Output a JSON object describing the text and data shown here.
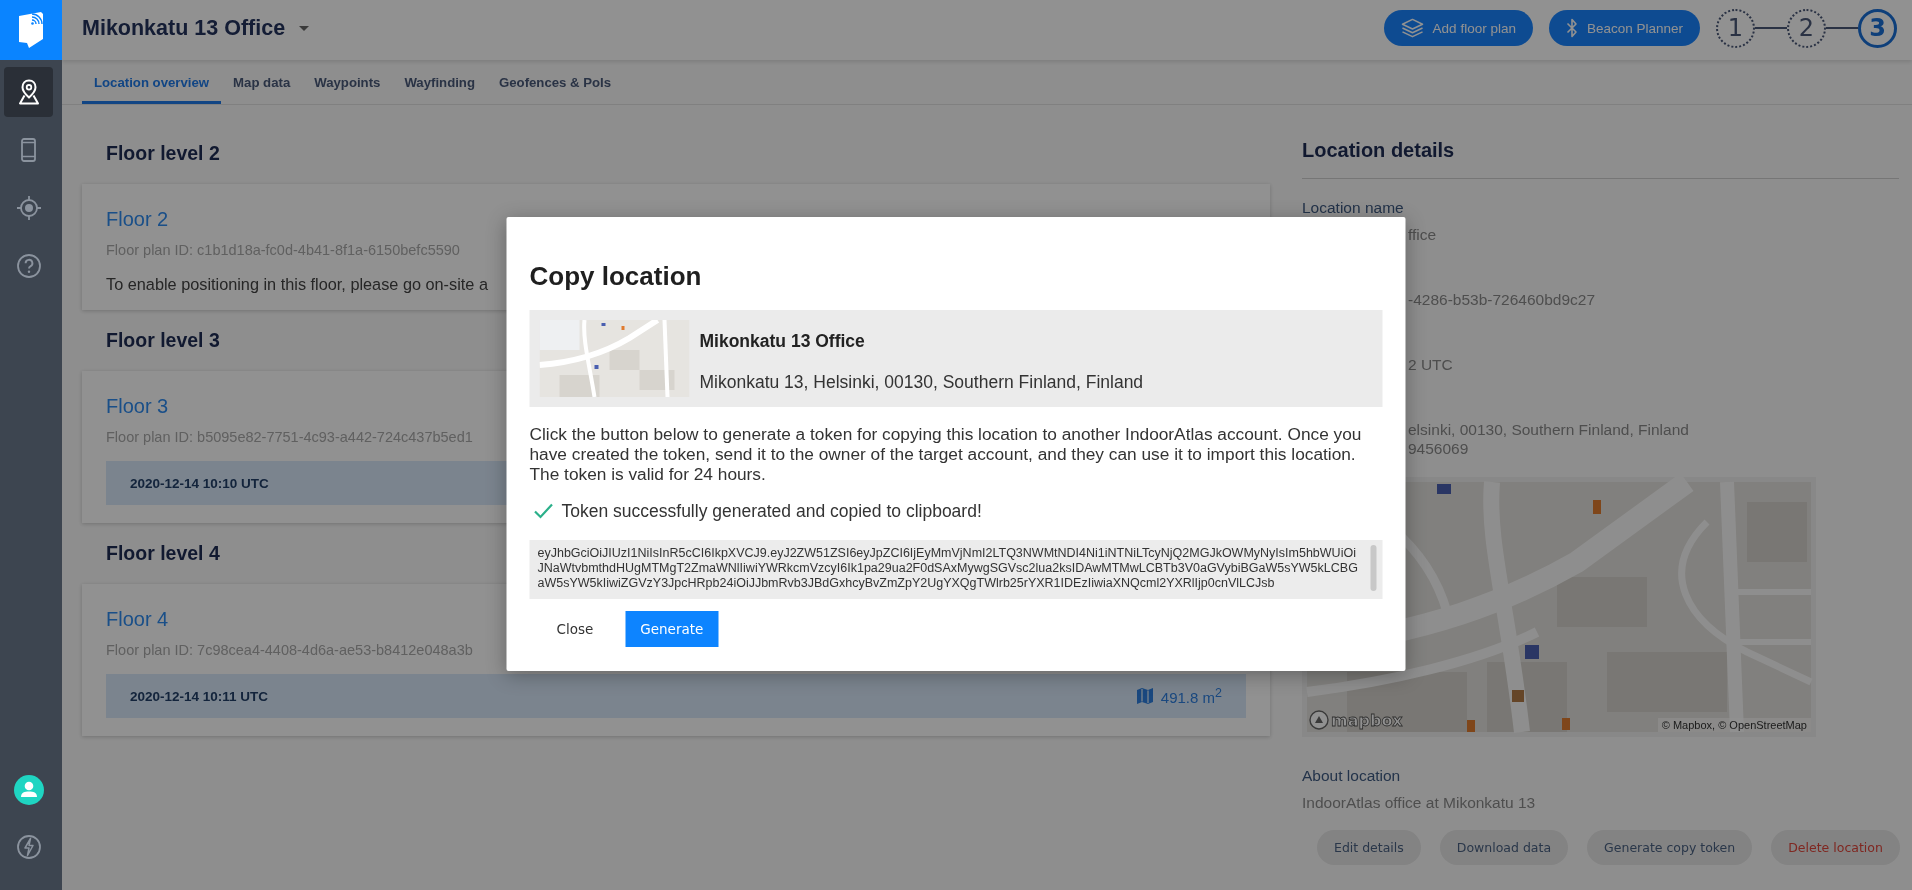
{
  "sidebar": {
    "items": [
      {
        "selected": true
      },
      {
        "selected": false
      },
      {
        "selected": false
      },
      {
        "selected": false
      }
    ]
  },
  "header": {
    "title": "Mikonkatu 13 Office",
    "buttons": [
      {
        "label": "Add floor plan"
      },
      {
        "label": "Beacon Planner"
      }
    ],
    "steps": [
      {
        "label": "1",
        "selected": false
      },
      {
        "label": "2",
        "selected": false
      },
      {
        "label": "3",
        "selected": true
      }
    ]
  },
  "tabs": [
    {
      "label": "Location overview",
      "selected": true
    },
    {
      "label": "Map data",
      "selected": false
    },
    {
      "label": "Waypoints",
      "selected": false
    },
    {
      "label": "Wayfinding",
      "selected": false
    },
    {
      "label": "Geofences & PoIs",
      "selected": false
    }
  ],
  "floors": [
    {
      "heading": "Floor level 2",
      "name": "Floor 2",
      "plan_id": "Floor plan ID: c1b1d18a-fc0d-4b41-8f1a-6150befc5590",
      "kind": "pending",
      "note": "To enable positioning in this floor, please go on-site a"
    },
    {
      "heading": "Floor level 3",
      "name": "Floor 3",
      "plan_id": "Floor plan ID: b5095e82-7751-4c93-a442-724c437b5ed1",
      "kind": "mapped",
      "date": "2020-12-14 10:10 UTC"
    },
    {
      "heading": "Floor level 4",
      "name": "Floor 4",
      "plan_id": "Floor plan ID: 7c98cea4-4408-4d6a-ae53-b8412e048a3b",
      "kind": "mapped",
      "date": "2020-12-14 10:11 UTC",
      "area": "491.8 m$^{2}$"
    }
  ],
  "details": {
    "title": "Location details",
    "fields": [
      {
        "label": "Location name",
        "lines": [
          "ffice"
        ]
      },
      {
        "lines": [
          "-4286-b53b-726460bd9c27"
        ]
      },
      {
        "lines": [
          "2 UTC"
        ]
      },
      {
        "lines": [
          "elsinki, 00130, Southern Finland, Finland",
          "9456069"
        ]
      }
    ],
    "map": {
      "logo": "mapbox",
      "attribution": "© Mapbox, © OpenStreetMap"
    },
    "about": {
      "label": "About location",
      "value": "IndoorAtlas office at Mikonkatu 13"
    },
    "actions": [
      {
        "label": "Edit details",
        "kind": "default"
      },
      {
        "label": "Download data",
        "kind": "default"
      },
      {
        "label": "Generate copy token",
        "kind": "default"
      },
      {
        "label": "Delete location",
        "kind": "danger"
      }
    ]
  },
  "modal": {
    "title": "Copy location",
    "location": {
      "name": "Mikonkatu 13 Office",
      "address": "Mikonkatu 13, Helsinki, 00130, Southern Finland, Finland"
    },
    "description": "Click the button below to generate a token for copying this location to another IndoorAtlas account. Once you have created the token, send it to the owner of the target account, and they can use it to import this location. The token is valid for 24 hours.",
    "success": "Token successfully generated and copied to clipboard!",
    "token": "eyJhbGciOiJIUzI1NiIsInR5cCI6IkpXVCJ9.eyJ2ZW51ZSI6eyJpZCI6IjEyMmVjNmI2LTQ3NWMtNDI4Ni1iNTNiLTcyNjQ2MGJkOWMyNyIsIm5hbWUiOiJNaWtvbmthdHUgMTMgT2ZmaWNlIiwiYWRkcmVzcyI6Ik1pa29ua2F0dSAxMywgSGVsc2lua2ksIDAwMTMwLCBTb3V0aGVybiBGaW5sYW5kLCBGaW5sYW5kIiwiZGVzY3JpcHRpb24iOiJJbmRvb3JBdGxhcyBvZmZpY2UgYXQgTWlrb25rYXR1IDEzIiwiaXNQcml2YXRlIjp0cnVlLCJsb",
    "buttons": [
      {
        "label": "Close",
        "kind": "text"
      },
      {
        "label": "Generate",
        "kind": "primary"
      }
    ]
  }
}
